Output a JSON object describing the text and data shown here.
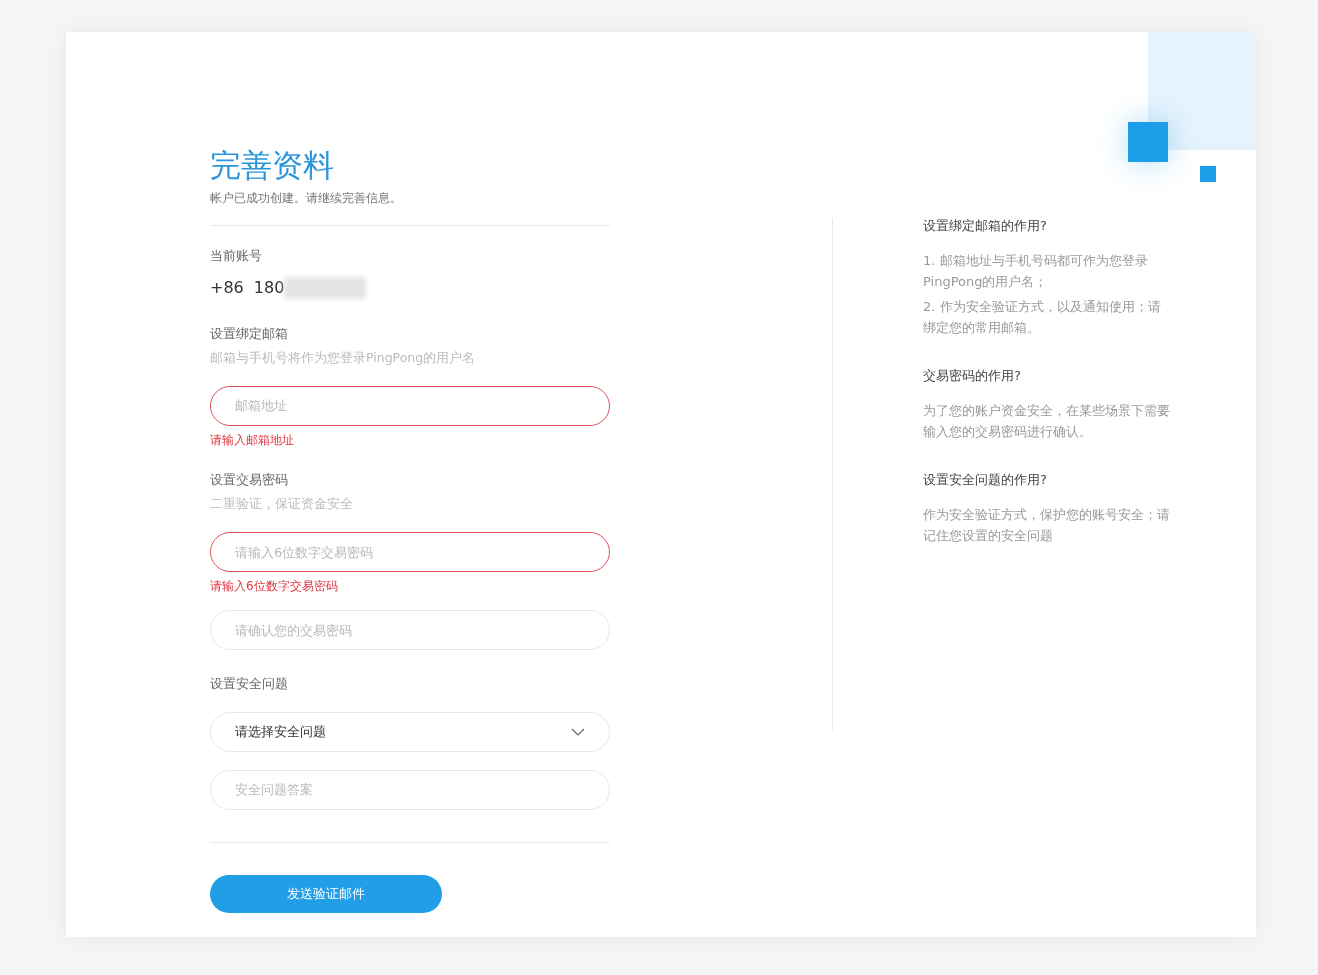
{
  "form": {
    "title": "完善资料",
    "subtitle": "帐户已成功创建。请继续完善信息。",
    "account": {
      "label": "当前账号",
      "country_code": "+86",
      "number": "180"
    },
    "sections": [
      {
        "label": "设置绑定邮箱",
        "hint": "邮箱与手机号将作为您登录PingPong的用户名",
        "fields": [
          {
            "kind": "input",
            "placeholder": "邮箱地址",
            "error": "请输入邮箱地址"
          }
        ]
      },
      {
        "label": "设置交易密码",
        "hint": "二重验证，保证资金安全",
        "fields": [
          {
            "kind": "input",
            "placeholder": "请输入6位数字交易密码",
            "error": "请输入6位数字交易密码"
          },
          {
            "kind": "input",
            "placeholder": "请确认您的交易密码"
          }
        ]
      },
      {
        "label": "设置安全问题",
        "fields": [
          {
            "kind": "select",
            "value": "请选择安全问题"
          },
          {
            "kind": "input",
            "placeholder": "安全问题答案"
          }
        ]
      }
    ],
    "submit": "发送验证邮件"
  },
  "help": [
    {
      "question": "设置绑定邮箱的作用?",
      "answers": [
        "1. 邮箱地址与手机号码都可作为您登录PingPong的用户名；",
        "2. 作为安全验证方式，以及通知使用；请绑定您的常用邮箱。"
      ]
    },
    {
      "question": "交易密码的作用?",
      "answers": [
        "为了您的账户资金安全，在某些场景下需要输入您的交易密码进行确认。"
      ]
    },
    {
      "question": "设置安全问题的作用?",
      "answers": [
        "作为安全验证方式，保护您的账号安全；请记住您设置的安全问题"
      ]
    }
  ]
}
